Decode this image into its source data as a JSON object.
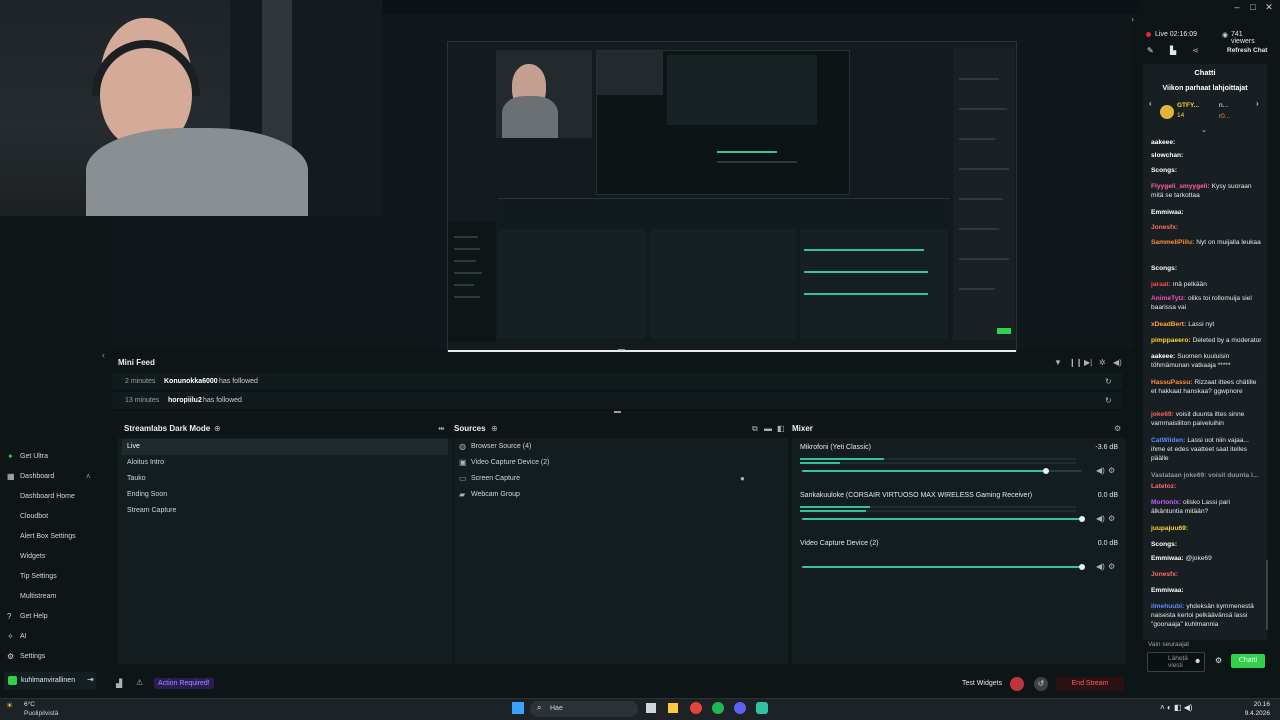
{
  "stream": {
    "live_time": "Live 02:16:09",
    "viewers": "741 viewers",
    "refresh_chat": "Refresh Chat"
  },
  "sidebar": {
    "items": [
      {
        "label": "Get Ultra",
        "icon": "ultra-icon"
      },
      {
        "label": "Dashboard",
        "icon": "dashboard-icon"
      },
      {
        "label": "Dashboard Home"
      },
      {
        "label": "Cloudbot"
      },
      {
        "label": "Alert Box Settings"
      },
      {
        "label": "Widgets"
      },
      {
        "label": "Tip Settings"
      },
      {
        "label": "Multistream"
      },
      {
        "label": "Get Help",
        "icon": "help-icon"
      },
      {
        "label": "AI",
        "icon": "ai-icon"
      },
      {
        "label": "Settings",
        "icon": "settings-icon"
      }
    ],
    "user": "kuhlmanvirallinen"
  },
  "minifeed": {
    "title": "Mini Feed",
    "rows": [
      {
        "time": "2 minutes",
        "name": "Konunokka6000",
        "action": "has followed"
      },
      {
        "time": "13 minutes",
        "name": "horopiilu2",
        "action": "has followed"
      }
    ]
  },
  "scenes": {
    "title": "Streamlabs Dark Mode",
    "items": [
      "Live",
      "Aloitus Intro",
      "Tauko",
      "Ending Soon",
      "Stream Capture"
    ]
  },
  "sources": {
    "title": "Sources",
    "items": [
      "Browser Source (4)",
      "Video Capture Device (2)",
      "Screen Capture",
      "Webcam Group"
    ]
  },
  "mixer": {
    "title": "Mixer",
    "channels": [
      {
        "name": "Mikrofoni (Yeti Classic)",
        "db": "-3.6 dB",
        "level": 0.87
      },
      {
        "name": "Sankakuuloke (CORSAIR VIRTUOSO MAX WIRELESS Gaming Receiver)",
        "db": "0.0 dB",
        "level": 1.0
      },
      {
        "name": "Video Capture Device (2)",
        "db": "0.0 dB",
        "level": 1.0
      }
    ]
  },
  "footer": {
    "action_required": "Action Required!",
    "test_widgets": "Test Widgets",
    "end_stream": "End Stream"
  },
  "chat": {
    "title": "Chatti",
    "gifters_title": "Viikon parhaat lahjoittajat",
    "gifter1": "GTFY...",
    "gifter1_count": "14",
    "gifter2": "n...",
    "gifter3": "r0...",
    "messages": [
      {
        "user": "aakeee:",
        "text": "",
        "color": "#ffffff"
      },
      {
        "user": "slowchan:",
        "text": "",
        "color": "#ffffff"
      },
      {
        "user": "Scongs:",
        "text": "",
        "color": "#ffffff"
      },
      {
        "user": "Flyygeli_smyygeli:",
        "text": "Kysy suoraan mitä se tarkottaa",
        "color": "#ff5fa2"
      },
      {
        "user": "Emmiwaa:",
        "text": "",
        "color": "#ffffff"
      },
      {
        "user": "Jonesfx:",
        "text": "",
        "color": "#ff6b6b"
      },
      {
        "user": "SammeliPiilu:",
        "text": "Nyt on muijalla leukaa",
        "color": "#ff8c3a"
      },
      {
        "user": "Scongs:",
        "text": "",
        "color": "#ffffff"
      },
      {
        "user": "jaraat:",
        "text": "mä pelkään",
        "color": "#ff4a4a"
      },
      {
        "user": "AnimeTytz:",
        "text": "oliks toi rollomuija siel baarissa vai",
        "color": "#ff4ab0"
      },
      {
        "user": "xDeadBert:",
        "text": "Lassi nyt",
        "color": "#ffa43a"
      },
      {
        "user": "pimppaeero:",
        "text": "Deleted by a moderator",
        "color": "#ffd23a"
      },
      {
        "user": "aakeee:",
        "text": "Suomen kuuluisin töhmämunan vatkaaja *****",
        "color": "#ffffff"
      },
      {
        "user": "HassuPassu:",
        "text": "Rizzaat ittees chätille et hakkaat hanskaa? ggwpnore",
        "color": "#ff8c3a"
      },
      {
        "user": "joke69:",
        "text": "voisit duunta ittes sinne vammaisliiton paiveluihin",
        "color": "#ff5f5f"
      },
      {
        "user": "CatWilden:",
        "text": "Lassi oot niin vajaa... ihme et edes vaatteet saat itelles päälle",
        "color": "#5f8cff"
      },
      {
        "user": "Vastataan joke69: voisit duunta i...",
        "text": "",
        "color": "#8d979b"
      },
      {
        "user": "Latetoz:",
        "text": "",
        "color": "#ff6b6b"
      },
      {
        "user": "Mortonix:",
        "text": "olisko Lassi pari älkäntuntia mitään?",
        "color": "#c05fff"
      },
      {
        "user": "juupajuu69:",
        "text": "",
        "color": "#ffd23a"
      },
      {
        "user": "Scongs:",
        "text": "",
        "color": "#ffffff"
      },
      {
        "user": "Emmiwaa:",
        "text": "@joke69",
        "color": "#ffffff"
      },
      {
        "user": "Jonesfx:",
        "text": "",
        "color": "#ff6b6b"
      },
      {
        "user": "Emmiwaa:",
        "text": "",
        "color": "#ffffff"
      },
      {
        "user": "ilmehuubi:",
        "text": "yhdeksän kymmenestä naisesta kertoi pelkäävänsä lassi \"goonaaja\" kuhlmannia",
        "color": "#5f8cff"
      }
    ],
    "followers_only": "Vain seuraajat",
    "input_placeholder": "Lähetä viesti",
    "send_label": "Chatti"
  },
  "taskbar": {
    "weather_temp": "6°C",
    "weather_desc": "Puolipilvistä",
    "search_placeholder": "Hae",
    "time": "20.16",
    "date": "9.4.2026"
  },
  "colors": {
    "accent": "#31c3a2",
    "danger": "#e02d2d",
    "send": "#32d14b"
  }
}
